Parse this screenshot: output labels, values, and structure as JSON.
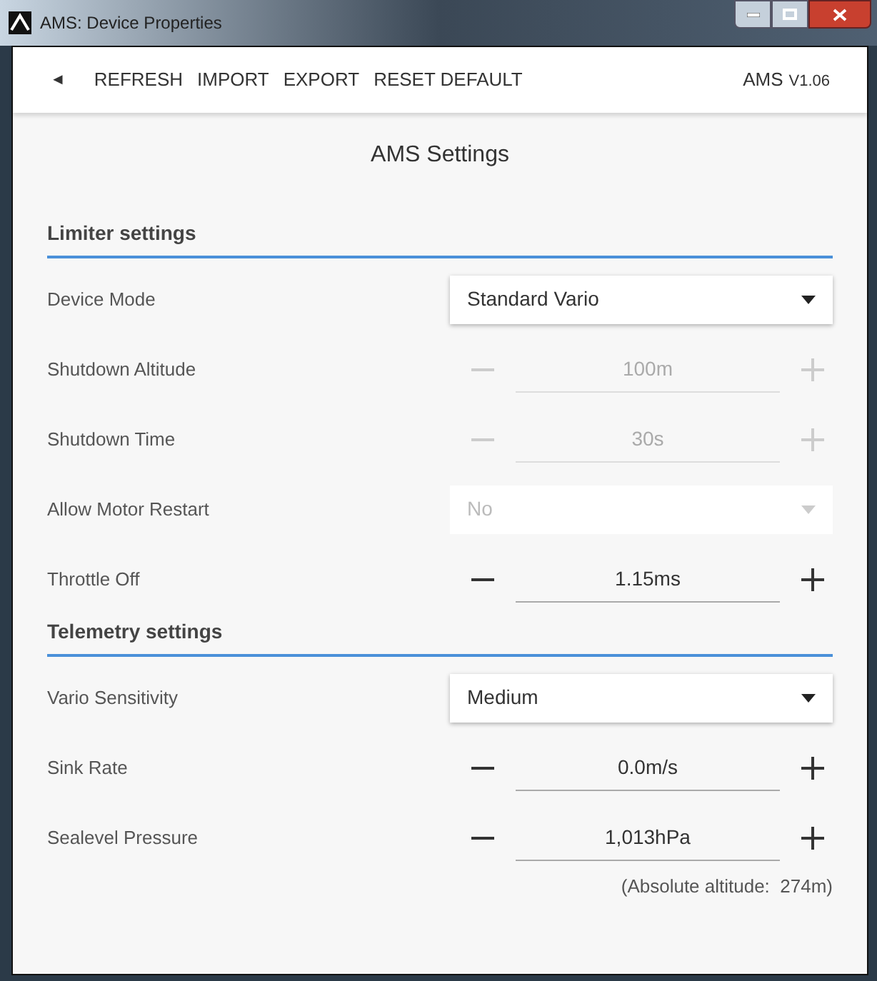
{
  "window": {
    "title": "AMS: Device Properties"
  },
  "toolbar": {
    "back": "◄",
    "actions": [
      "REFRESH",
      "IMPORT",
      "EXPORT",
      "RESET DEFAULT"
    ],
    "app_name": "AMS",
    "version": "V1.06"
  },
  "page_title": "AMS Settings",
  "sections": [
    {
      "title": "Limiter settings",
      "rows": [
        {
          "kind": "select",
          "label": "Device Mode",
          "value": "Standard Vario",
          "disabled": false
        },
        {
          "kind": "stepper",
          "label": "Shutdown Altitude",
          "value": "100m",
          "disabled": true
        },
        {
          "kind": "stepper",
          "label": "Shutdown Time",
          "value": "30s",
          "disabled": true
        },
        {
          "kind": "select",
          "label": "Allow Motor Restart",
          "value": "No",
          "disabled": true
        },
        {
          "kind": "stepper",
          "label": "Throttle Off",
          "value": "1.15ms",
          "disabled": false
        }
      ]
    },
    {
      "title": "Telemetry settings",
      "rows": [
        {
          "kind": "select",
          "label": "Vario Sensitivity",
          "value": "Medium",
          "disabled": false
        },
        {
          "kind": "stepper",
          "label": "Sink Rate",
          "value": "0.0m/s",
          "disabled": false
        },
        {
          "kind": "stepper",
          "label": "Sealevel Pressure",
          "value": "1,013hPa",
          "disabled": false
        }
      ]
    }
  ],
  "note": "(Absolute altitude:  274m)"
}
